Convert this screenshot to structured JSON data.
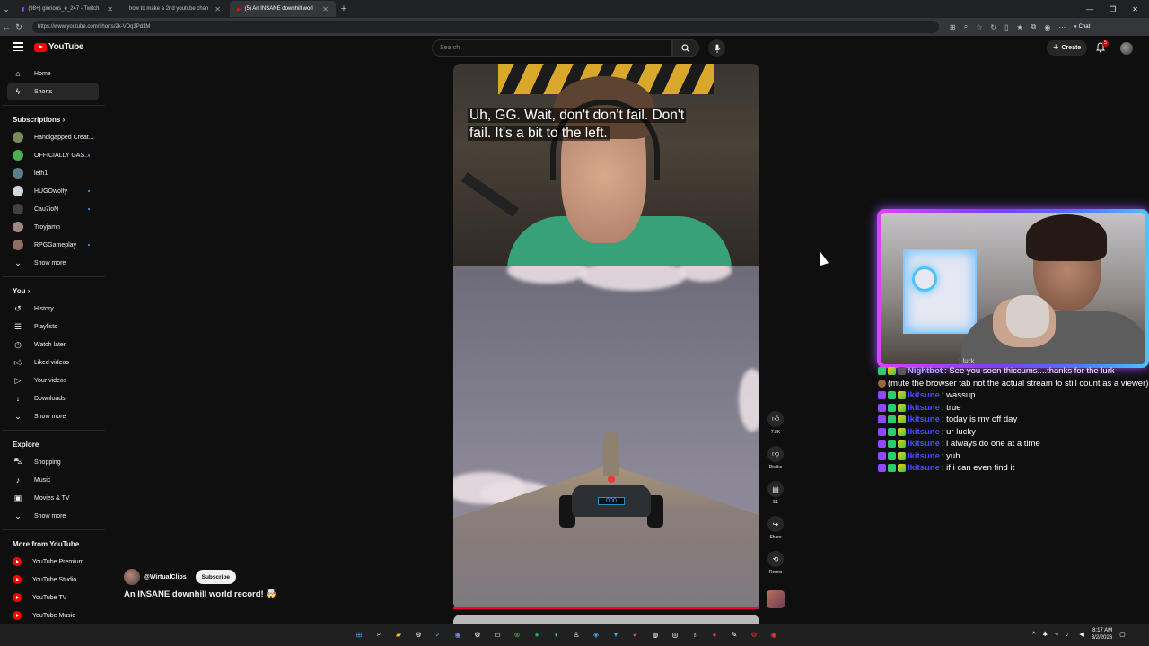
{
  "browser": {
    "tabs": [
      {
        "label": "(98+) glorious_e_247 - Twitch",
        "active": false
      },
      {
        "label": "how to make a 2nd youtube chan",
        "active": false
      },
      {
        "label": "(5) An INSANE downhill worl",
        "active": true
      }
    ],
    "url": "https://www.youtube.com/shorts/2k-VDq3Pd1M",
    "chat_label": "Chat"
  },
  "youtube": {
    "logo_text": "YouTube",
    "search_placeholder": "Search",
    "create_label": "Create",
    "notification_count": "5"
  },
  "sidebar": {
    "main": [
      {
        "label": "Home",
        "icon": "home-icon"
      },
      {
        "label": "Shorts",
        "icon": "shorts-icon",
        "active": true
      }
    ],
    "subscriptions_heading": "Subscriptions",
    "subscriptions": [
      {
        "label": "Handigapped Creat...",
        "live": false,
        "color": "#7a8c5c"
      },
      {
        "label": "OFFICIALLY GAS...",
        "live": true,
        "color": "#4caf50"
      },
      {
        "label": "leth1",
        "live": false,
        "color": "#607d8b"
      },
      {
        "label": "HUGOwolfy",
        "live": true,
        "color": "#cfd8dc"
      },
      {
        "label": "Cau7ioN",
        "live": true,
        "color": "#424242"
      },
      {
        "label": "Troyjamn",
        "live": false,
        "color": "#a1887f"
      },
      {
        "label": "RPGGameplay",
        "live": true,
        "color": "#8d6e63"
      }
    ],
    "subs_show_more": "Show more",
    "you_heading": "You",
    "you_items": [
      {
        "label": "History",
        "icon": "history-icon"
      },
      {
        "label": "Playlists",
        "icon": "playlists-icon"
      },
      {
        "label": "Watch later",
        "icon": "watch-later-icon"
      },
      {
        "label": "Liked videos",
        "icon": "liked-videos-icon"
      },
      {
        "label": "Your videos",
        "icon": "your-videos-icon"
      },
      {
        "label": "Downloads",
        "icon": "downloads-icon"
      }
    ],
    "you_show_more": "Show more",
    "explore_heading": "Explore",
    "explore_items": [
      {
        "label": "Shopping",
        "icon": "shopping-icon"
      },
      {
        "label": "Music",
        "icon": "music-icon"
      },
      {
        "label": "Movies & TV",
        "icon": "movies-icon"
      }
    ],
    "explore_show_more": "Show more",
    "more_heading": "More from YouTube",
    "more_items": [
      {
        "label": "YouTube Premium"
      },
      {
        "label": "YouTube Studio"
      },
      {
        "label": "YouTube TV"
      },
      {
        "label": "YouTube Music"
      }
    ]
  },
  "short": {
    "caption_line1": "Uh, GG. Wait, don't don't fail. Don't",
    "caption_line2": "fail. It's a bit to the left.",
    "car_display": "000",
    "channel_handle": "@WirtualClips",
    "subscribe_label": "Subscribe",
    "title": "An INSANE downhill world record! 🤯",
    "progress_fraction": 0.99,
    "actions": {
      "like_count": "7.8K",
      "dislike_label": "Dislike",
      "comment_count": "51",
      "share_label": "Share",
      "remix_label": "Remix"
    }
  },
  "stream_chat": [
    {
      "type": "partial",
      "text": ": lurk"
    },
    {
      "type": "bot",
      "name": "Nightbot",
      "message": ": See you soon thiccums....thanks for the lurk"
    },
    {
      "type": "note",
      "message": "(mute the browser tab not the actual stream to still count as a viewer)"
    },
    {
      "type": "user",
      "name": "Ikitsune",
      "message": ": wassup"
    },
    {
      "type": "user",
      "name": "Ikitsune",
      "message": ": true"
    },
    {
      "type": "user",
      "name": "Ikitsune",
      "message": ": today is my off day"
    },
    {
      "type": "user",
      "name": "Ikitsune",
      "message": ": ur lucky"
    },
    {
      "type": "user",
      "name": "Ikitsune",
      "message": ": i always do one at a time"
    },
    {
      "type": "user",
      "name": "Ikitsune",
      "message": ": yuh"
    },
    {
      "type": "user",
      "name": "Ikitsune",
      "message": ": if i can even find it"
    }
  ],
  "taskbar": {
    "time": "8:17 AM",
    "date": "3/2/2026"
  }
}
